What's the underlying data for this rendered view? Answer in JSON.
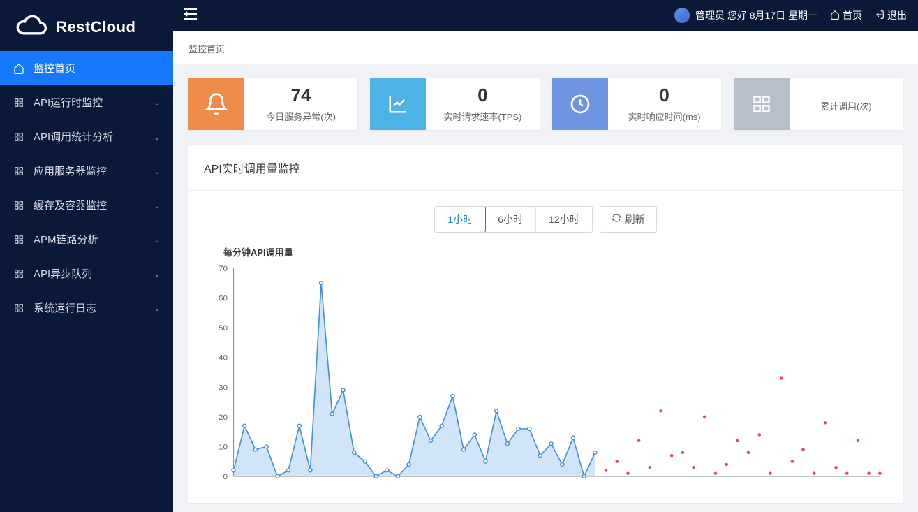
{
  "brand": {
    "name": "RestCloud"
  },
  "topbar": {
    "greeting": "管理员 您好 8月17日 星期一",
    "home_label": "首页",
    "logout_label": "退出"
  },
  "sidebar": {
    "items": [
      {
        "label": "监控首页",
        "icon": "home",
        "active": true,
        "expandable": false
      },
      {
        "label": "API运行时监控",
        "icon": "grid",
        "active": false,
        "expandable": true
      },
      {
        "label": "API调用统计分析",
        "icon": "grid",
        "active": false,
        "expandable": true
      },
      {
        "label": "应用服务器监控",
        "icon": "grid",
        "active": false,
        "expandable": true
      },
      {
        "label": "缓存及容器监控",
        "icon": "grid",
        "active": false,
        "expandable": true
      },
      {
        "label": "APM链路分析",
        "icon": "grid",
        "active": false,
        "expandable": true
      },
      {
        "label": "API异步队列",
        "icon": "grid",
        "active": false,
        "expandable": true
      },
      {
        "label": "系统运行日志",
        "icon": "grid",
        "active": false,
        "expandable": true
      }
    ]
  },
  "breadcrumb": "监控首页",
  "stats": [
    {
      "value": "74",
      "label": "今日服务异常(次)",
      "color": "orange",
      "icon": "bell"
    },
    {
      "value": "0",
      "label": "实时请求速率(TPS)",
      "color": "blue",
      "icon": "chart"
    },
    {
      "value": "0",
      "label": "实时响应时间(ms)",
      "color": "indigo",
      "icon": "clock"
    },
    {
      "value": "",
      "label": "累计调用(次)",
      "color": "gray",
      "icon": "grid4"
    }
  ],
  "panel": {
    "title": "API实时调用量监控",
    "ranges": [
      {
        "label": "1小时",
        "active": true
      },
      {
        "label": "6小时",
        "active": false
      },
      {
        "label": "12小时",
        "active": false
      }
    ],
    "refresh_label": "刷新"
  },
  "chart_data": {
    "type": "line",
    "title": "每分钟API调用量",
    "xlabel": "",
    "ylabel": "",
    "ylim": [
      0,
      70
    ],
    "yticks": [
      0,
      10,
      20,
      30,
      40,
      50,
      60,
      70
    ],
    "series": [
      {
        "name": "line",
        "style": "area-line",
        "values": [
          2,
          17,
          9,
          10,
          0,
          2,
          17,
          2,
          65,
          21,
          29,
          8,
          5,
          0,
          2,
          0,
          4,
          20,
          12,
          17,
          27,
          9,
          14,
          5,
          22,
          11,
          16,
          16,
          7,
          11,
          4,
          13,
          0,
          8
        ]
      },
      {
        "name": "dots",
        "style": "scatter",
        "values": [
          null,
          null,
          null,
          null,
          null,
          null,
          null,
          null,
          null,
          null,
          null,
          null,
          null,
          null,
          null,
          null,
          null,
          null,
          null,
          null,
          null,
          null,
          null,
          null,
          null,
          null,
          null,
          null,
          null,
          null,
          null,
          null,
          null,
          null,
          2,
          5,
          1,
          12,
          3,
          22,
          7,
          8,
          3,
          20,
          1,
          4,
          12,
          8,
          14,
          1,
          33,
          5,
          9,
          1,
          18,
          3,
          1,
          12,
          1,
          1
        ]
      }
    ],
    "x_count": 60
  }
}
